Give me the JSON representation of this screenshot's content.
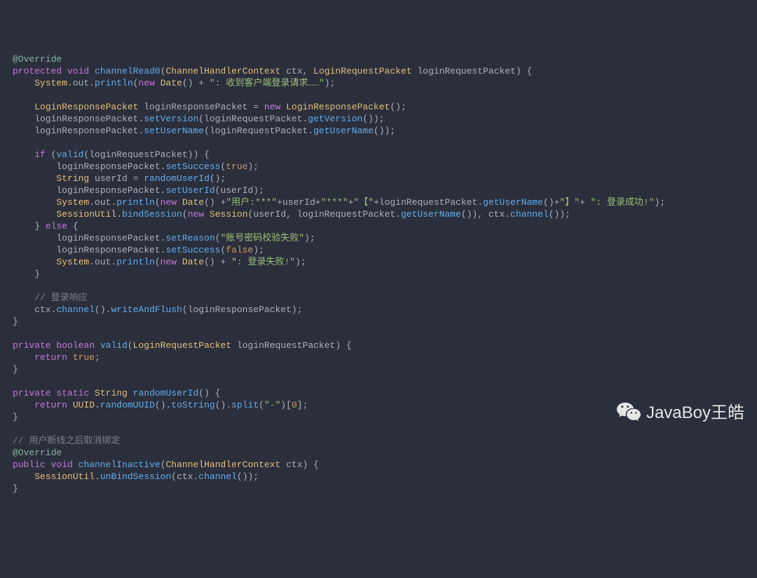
{
  "watermark": {
    "text": "JavaBoy王皓"
  },
  "code": {
    "lines": [
      [
        {
          "cls": "ann",
          "t": "@Override"
        }
      ],
      [
        {
          "cls": "kw",
          "t": "protected"
        },
        {
          "cls": "pun",
          "t": " "
        },
        {
          "cls": "kw",
          "t": "void"
        },
        {
          "cls": "pun",
          "t": " "
        },
        {
          "cls": "fn",
          "t": "channelRead0"
        },
        {
          "cls": "pun",
          "t": "("
        },
        {
          "cls": "typ",
          "t": "ChannelHandlerContext"
        },
        {
          "cls": "pun",
          "t": " ctx, "
        },
        {
          "cls": "typ",
          "t": "LoginRequestPacket"
        },
        {
          "cls": "pun",
          "t": " loginRequestPacket) {"
        }
      ],
      [
        {
          "cls": "pun",
          "t": "    "
        },
        {
          "cls": "typ",
          "t": "System"
        },
        {
          "cls": "pun",
          "t": ".out."
        },
        {
          "cls": "fn",
          "t": "println"
        },
        {
          "cls": "pun",
          "t": "("
        },
        {
          "cls": "kw",
          "t": "new"
        },
        {
          "cls": "pun",
          "t": " "
        },
        {
          "cls": "typ",
          "t": "Date"
        },
        {
          "cls": "pun",
          "t": "() + "
        },
        {
          "cls": "str",
          "t": "\": 收到客户端登录请求……\""
        },
        {
          "cls": "pun",
          "t": ");"
        }
      ],
      [
        {
          "cls": "pun",
          "t": ""
        }
      ],
      [
        {
          "cls": "pun",
          "t": "    "
        },
        {
          "cls": "typ",
          "t": "LoginResponsePacket"
        },
        {
          "cls": "pun",
          "t": " loginResponsePacket = "
        },
        {
          "cls": "kw",
          "t": "new"
        },
        {
          "cls": "pun",
          "t": " "
        },
        {
          "cls": "typ",
          "t": "LoginResponsePacket"
        },
        {
          "cls": "pun",
          "t": "();"
        }
      ],
      [
        {
          "cls": "pun",
          "t": "    loginResponsePacket."
        },
        {
          "cls": "fn",
          "t": "setVersion"
        },
        {
          "cls": "pun",
          "t": "(loginRequestPacket."
        },
        {
          "cls": "fn",
          "t": "getVersion"
        },
        {
          "cls": "pun",
          "t": "());"
        }
      ],
      [
        {
          "cls": "pun",
          "t": "    loginResponsePacket."
        },
        {
          "cls": "fn",
          "t": "setUserName"
        },
        {
          "cls": "pun",
          "t": "(loginRequestPacket."
        },
        {
          "cls": "fn",
          "t": "getUserName"
        },
        {
          "cls": "pun",
          "t": "());"
        }
      ],
      [
        {
          "cls": "pun",
          "t": ""
        }
      ],
      [
        {
          "cls": "pun",
          "t": "    "
        },
        {
          "cls": "kw",
          "t": "if"
        },
        {
          "cls": "pun",
          "t": " ("
        },
        {
          "cls": "fn",
          "t": "valid"
        },
        {
          "cls": "pun",
          "t": "(loginRequestPacket)) {"
        }
      ],
      [
        {
          "cls": "pun",
          "t": "        loginResponsePacket."
        },
        {
          "cls": "fn",
          "t": "setSuccess"
        },
        {
          "cls": "pun",
          "t": "("
        },
        {
          "cls": "num",
          "t": "true"
        },
        {
          "cls": "pun",
          "t": ");"
        }
      ],
      [
        {
          "cls": "pun",
          "t": "        "
        },
        {
          "cls": "typ",
          "t": "String"
        },
        {
          "cls": "pun",
          "t": " userId = "
        },
        {
          "cls": "fn",
          "t": "randomUserId"
        },
        {
          "cls": "pun",
          "t": "();"
        }
      ],
      [
        {
          "cls": "pun",
          "t": "        loginResponsePacket."
        },
        {
          "cls": "fn",
          "t": "setUserId"
        },
        {
          "cls": "pun",
          "t": "(userId);"
        }
      ],
      [
        {
          "cls": "pun",
          "t": "        "
        },
        {
          "cls": "typ",
          "t": "System"
        },
        {
          "cls": "pun",
          "t": ".out."
        },
        {
          "cls": "fn",
          "t": "println"
        },
        {
          "cls": "pun",
          "t": "("
        },
        {
          "cls": "kw",
          "t": "new"
        },
        {
          "cls": "pun",
          "t": " "
        },
        {
          "cls": "typ",
          "t": "Date"
        },
        {
          "cls": "pun",
          "t": "() +"
        },
        {
          "cls": "str",
          "t": "\"用户:***\""
        },
        {
          "cls": "pun",
          "t": "+userId+"
        },
        {
          "cls": "str",
          "t": "\"***\""
        },
        {
          "cls": "pun",
          "t": "+"
        },
        {
          "cls": "str",
          "t": "\"【\""
        },
        {
          "cls": "pun",
          "t": "+loginRequestPacket."
        },
        {
          "cls": "fn",
          "t": "getUserName"
        },
        {
          "cls": "pun",
          "t": "()+"
        },
        {
          "cls": "str",
          "t": "\"】\""
        },
        {
          "cls": "pun",
          "t": "+ "
        },
        {
          "cls": "str",
          "t": "\": 登录成功!\""
        },
        {
          "cls": "pun",
          "t": ");"
        }
      ],
      [
        {
          "cls": "pun",
          "t": "        "
        },
        {
          "cls": "typ",
          "t": "SessionUtil"
        },
        {
          "cls": "pun",
          "t": "."
        },
        {
          "cls": "fn",
          "t": "bindSession"
        },
        {
          "cls": "pun",
          "t": "("
        },
        {
          "cls": "kw",
          "t": "new"
        },
        {
          "cls": "pun",
          "t": " "
        },
        {
          "cls": "typ",
          "t": "Session"
        },
        {
          "cls": "pun",
          "t": "(userId, loginRequestPacket."
        },
        {
          "cls": "fn",
          "t": "getUserName"
        },
        {
          "cls": "pun",
          "t": "()), ctx."
        },
        {
          "cls": "fn",
          "t": "channel"
        },
        {
          "cls": "pun",
          "t": "());"
        }
      ],
      [
        {
          "cls": "pun",
          "t": "    } "
        },
        {
          "cls": "kw",
          "t": "else"
        },
        {
          "cls": "pun",
          "t": " {"
        }
      ],
      [
        {
          "cls": "pun",
          "t": "        loginResponsePacket."
        },
        {
          "cls": "fn",
          "t": "setReason"
        },
        {
          "cls": "pun",
          "t": "("
        },
        {
          "cls": "str",
          "t": "\"账号密码校验失败\""
        },
        {
          "cls": "pun",
          "t": ");"
        }
      ],
      [
        {
          "cls": "pun",
          "t": "        loginResponsePacket."
        },
        {
          "cls": "fn",
          "t": "setSuccess"
        },
        {
          "cls": "pun",
          "t": "("
        },
        {
          "cls": "num",
          "t": "false"
        },
        {
          "cls": "pun",
          "t": ");"
        }
      ],
      [
        {
          "cls": "pun",
          "t": "        "
        },
        {
          "cls": "typ",
          "t": "System"
        },
        {
          "cls": "pun",
          "t": ".out."
        },
        {
          "cls": "fn",
          "t": "println"
        },
        {
          "cls": "pun",
          "t": "("
        },
        {
          "cls": "kw",
          "t": "new"
        },
        {
          "cls": "pun",
          "t": " "
        },
        {
          "cls": "typ",
          "t": "Date"
        },
        {
          "cls": "pun",
          "t": "() + "
        },
        {
          "cls": "str",
          "t": "\": 登录失败!\""
        },
        {
          "cls": "pun",
          "t": ");"
        }
      ],
      [
        {
          "cls": "pun",
          "t": "    }"
        }
      ],
      [
        {
          "cls": "pun",
          "t": ""
        }
      ],
      [
        {
          "cls": "pun",
          "t": "    "
        },
        {
          "cls": "cmt",
          "t": "// 登录响应"
        }
      ],
      [
        {
          "cls": "pun",
          "t": "    ctx."
        },
        {
          "cls": "fn",
          "t": "channel"
        },
        {
          "cls": "pun",
          "t": "()."
        },
        {
          "cls": "fn",
          "t": "writeAndFlush"
        },
        {
          "cls": "pun",
          "t": "(loginResponsePacket);"
        }
      ],
      [
        {
          "cls": "pun",
          "t": "}"
        }
      ],
      [
        {
          "cls": "pun",
          "t": ""
        }
      ],
      [
        {
          "cls": "kw",
          "t": "private"
        },
        {
          "cls": "pun",
          "t": " "
        },
        {
          "cls": "kw",
          "t": "boolean"
        },
        {
          "cls": "pun",
          "t": " "
        },
        {
          "cls": "fn",
          "t": "valid"
        },
        {
          "cls": "pun",
          "t": "("
        },
        {
          "cls": "typ",
          "t": "LoginRequestPacket"
        },
        {
          "cls": "pun",
          "t": " loginRequestPacket) {"
        }
      ],
      [
        {
          "cls": "pun",
          "t": "    "
        },
        {
          "cls": "kw",
          "t": "return"
        },
        {
          "cls": "pun",
          "t": " "
        },
        {
          "cls": "num",
          "t": "true"
        },
        {
          "cls": "pun",
          "t": ";"
        }
      ],
      [
        {
          "cls": "pun",
          "t": "}"
        }
      ],
      [
        {
          "cls": "pun",
          "t": ""
        }
      ],
      [
        {
          "cls": "kw",
          "t": "private"
        },
        {
          "cls": "pun",
          "t": " "
        },
        {
          "cls": "kw",
          "t": "static"
        },
        {
          "cls": "pun",
          "t": " "
        },
        {
          "cls": "typ",
          "t": "String"
        },
        {
          "cls": "pun",
          "t": " "
        },
        {
          "cls": "fn",
          "t": "randomUserId"
        },
        {
          "cls": "pun",
          "t": "() {"
        }
      ],
      [
        {
          "cls": "pun",
          "t": "    "
        },
        {
          "cls": "kw",
          "t": "return"
        },
        {
          "cls": "pun",
          "t": " "
        },
        {
          "cls": "typ",
          "t": "UUID"
        },
        {
          "cls": "pun",
          "t": "."
        },
        {
          "cls": "fn",
          "t": "randomUUID"
        },
        {
          "cls": "pun",
          "t": "()."
        },
        {
          "cls": "fn",
          "t": "toString"
        },
        {
          "cls": "pun",
          "t": "()."
        },
        {
          "cls": "fn",
          "t": "split"
        },
        {
          "cls": "pun",
          "t": "("
        },
        {
          "cls": "str",
          "t": "\"-\""
        },
        {
          "cls": "pun",
          "t": ")["
        },
        {
          "cls": "num",
          "t": "0"
        },
        {
          "cls": "pun",
          "t": "];"
        }
      ],
      [
        {
          "cls": "pun",
          "t": "}"
        }
      ],
      [
        {
          "cls": "pun",
          "t": ""
        }
      ],
      [
        {
          "cls": "cmt",
          "t": "// 用户断线之后取消绑定"
        }
      ],
      [
        {
          "cls": "ann",
          "t": "@Override"
        }
      ],
      [
        {
          "cls": "kw",
          "t": "public"
        },
        {
          "cls": "pun",
          "t": " "
        },
        {
          "cls": "kw",
          "t": "void"
        },
        {
          "cls": "pun",
          "t": " "
        },
        {
          "cls": "fn",
          "t": "channelInactive"
        },
        {
          "cls": "pun",
          "t": "("
        },
        {
          "cls": "typ",
          "t": "ChannelHandlerContext"
        },
        {
          "cls": "pun",
          "t": " ctx) {"
        }
      ],
      [
        {
          "cls": "pun",
          "t": "    "
        },
        {
          "cls": "typ",
          "t": "SessionUtil"
        },
        {
          "cls": "pun",
          "t": "."
        },
        {
          "cls": "fn",
          "t": "unBindSession"
        },
        {
          "cls": "pun",
          "t": "(ctx."
        },
        {
          "cls": "fn",
          "t": "channel"
        },
        {
          "cls": "pun",
          "t": "());"
        }
      ],
      [
        {
          "cls": "pun",
          "t": "}"
        }
      ]
    ]
  }
}
